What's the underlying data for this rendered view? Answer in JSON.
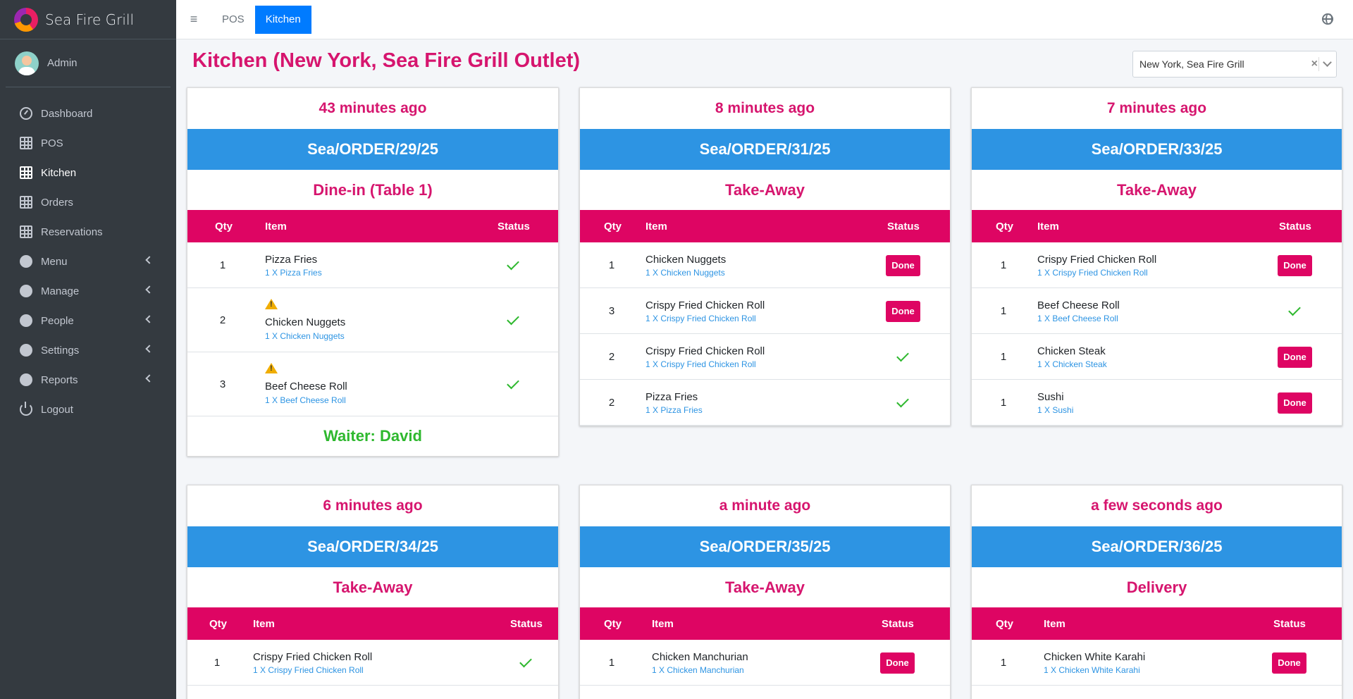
{
  "brand": {
    "name": "Sea Fire Grill"
  },
  "user": {
    "name": "Admin"
  },
  "sidebar": {
    "items": [
      {
        "label": "Dashboard"
      },
      {
        "label": "POS"
      },
      {
        "label": "Kitchen"
      },
      {
        "label": "Orders"
      },
      {
        "label": "Reservations"
      },
      {
        "label": "Menu"
      },
      {
        "label": "Manage"
      },
      {
        "label": "People"
      },
      {
        "label": "Settings"
      },
      {
        "label": "Reports"
      },
      {
        "label": "Logout"
      }
    ]
  },
  "topbar": {
    "menu_glyph": "≡",
    "pos_label": "POS",
    "kitchen_label": "Kitchen"
  },
  "page": {
    "title": "Kitchen (New York, Sea Fire Grill Outlet)"
  },
  "outlet_select": {
    "value": "New York, Sea Fire Grill",
    "clear_glyph": "×"
  },
  "table_headers": {
    "qty": "Qty",
    "item": "Item",
    "status": "Status"
  },
  "done_label": "Done",
  "orders": [
    {
      "time": "43 minutes ago",
      "number": "Sea/ORDER/29/25",
      "type": "Dine-in (Table 1)",
      "waiter": "Waiter: David",
      "items": [
        {
          "qty": "1",
          "name": "Pizza Fries",
          "detail": "1 X Pizza Fries",
          "status": "done",
          "warning": false
        },
        {
          "qty": "2",
          "name": "Chicken Nuggets",
          "detail": "1 X Chicken Nuggets",
          "status": "done",
          "warning": true
        },
        {
          "qty": "3",
          "name": "Beef Cheese Roll",
          "detail": "1 X Beef Cheese Roll",
          "status": "done",
          "warning": true
        }
      ]
    },
    {
      "time": "8 minutes ago",
      "number": "Sea/ORDER/31/25",
      "type": "Take-Away",
      "items": [
        {
          "qty": "1",
          "name": "Chicken Nuggets",
          "detail": "1 X Chicken Nuggets",
          "status": "pending"
        },
        {
          "qty": "3",
          "name": "Crispy Fried Chicken Roll",
          "detail": "1 X Crispy Fried Chicken Roll",
          "status": "pending"
        },
        {
          "qty": "2",
          "name": "Crispy Fried Chicken Roll",
          "detail": "1 X Crispy Fried Chicken Roll",
          "status": "done"
        },
        {
          "qty": "2",
          "name": "Pizza Fries",
          "detail": "1 X Pizza Fries",
          "status": "done"
        }
      ]
    },
    {
      "time": "7 minutes ago",
      "number": "Sea/ORDER/33/25",
      "type": "Take-Away",
      "items": [
        {
          "qty": "1",
          "name": "Crispy Fried Chicken Roll",
          "detail": "1 X Crispy Fried Chicken Roll",
          "status": "pending"
        },
        {
          "qty": "1",
          "name": "Beef Cheese Roll",
          "detail": "1 X Beef Cheese Roll",
          "status": "done"
        },
        {
          "qty": "1",
          "name": "Chicken Steak",
          "detail": "1 X Chicken Steak",
          "status": "pending"
        },
        {
          "qty": "1",
          "name": "Sushi",
          "detail": "1 X Sushi",
          "status": "pending"
        }
      ]
    },
    {
      "time": "6 minutes ago",
      "number": "Sea/ORDER/34/25",
      "type": "Take-Away",
      "items": [
        {
          "qty": "1",
          "name": "Crispy Fried Chicken Roll",
          "detail": "1 X Crispy Fried Chicken Roll",
          "status": "done"
        }
      ]
    },
    {
      "time": "a minute ago",
      "number": "Sea/ORDER/35/25",
      "type": "Take-Away",
      "items": [
        {
          "qty": "1",
          "name": "Chicken Manchurian",
          "detail": "1 X Chicken Manchurian",
          "status": "pending"
        }
      ]
    },
    {
      "time": "a few seconds ago",
      "number": "Sea/ORDER/36/25",
      "type": "Delivery",
      "items": [
        {
          "qty": "1",
          "name": "Chicken White Karahi",
          "detail": "1 X Chicken White Karahi",
          "status": "pending"
        }
      ]
    }
  ]
}
